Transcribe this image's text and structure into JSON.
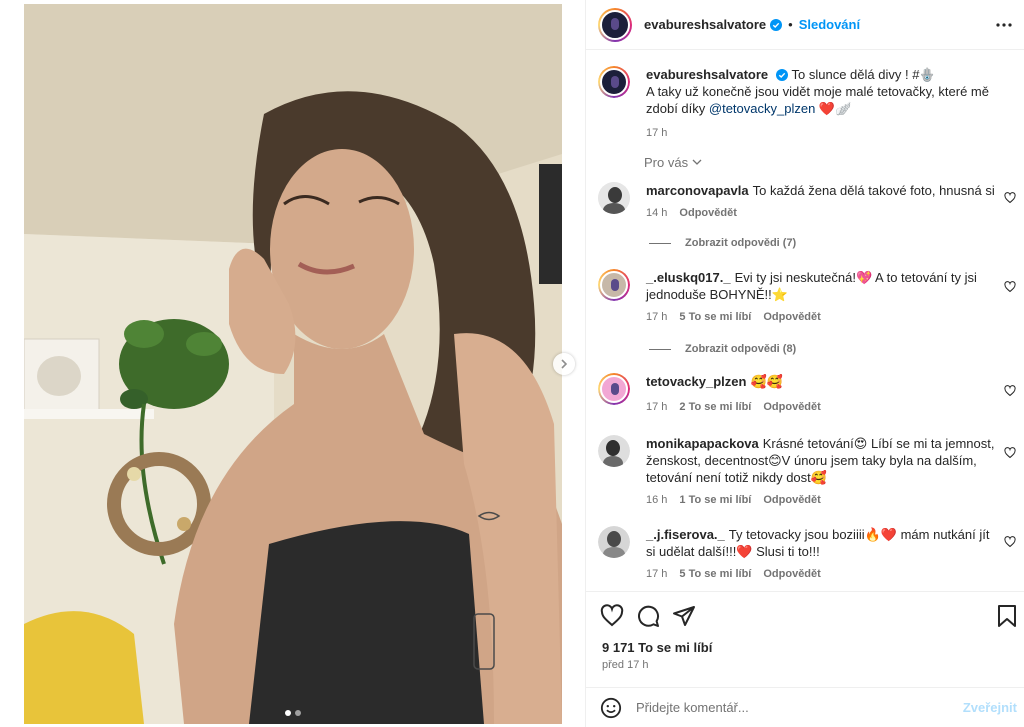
{
  "post": {
    "author": "evabureshsalvatore",
    "follow_label": "Sledování",
    "separator": "•",
    "caption_line1": "To slunce dělá divy ! #🪬",
    "caption_line2": "A taky už konečně jsou vidět moje malé tetovačky, které mě zdobí díky",
    "caption_mention": "@tetovacky_plzen",
    "caption_end": " ❤️🪽",
    "time": "17 h",
    "for_you_label": "Pro vás"
  },
  "comments": [
    {
      "user": "marconovapavla",
      "text": "To každá žena dělá takové foto, hnusná si",
      "time": "14 h",
      "likes": "",
      "reply": "Odpovědět",
      "view_replies": "Zobrazit odpovědi (7)"
    },
    {
      "user": "_.eluskq017._",
      "text": "Evi ty jsi neskutečná!💖 A to tetování ty jsi jednoduše BOHYNĚ!!⭐️",
      "time": "17 h",
      "likes": "5 To se mi líbí",
      "reply": "Odpovědět",
      "view_replies": "Zobrazit odpovědi (8)"
    },
    {
      "user": "tetovacky_plzen",
      "text": "🥰🥰",
      "time": "17 h",
      "likes": "2 To se mi líbí",
      "reply": "Odpovědět",
      "view_replies": ""
    },
    {
      "user": "monikapapackova",
      "text": "Krásné tetování😍 Líbí se mi ta jemnost, ženskost, decentnost😊V únoru jsem taky byla na dalším, tetování není totiž nikdy dost🥰",
      "time": "16 h",
      "likes": "1 To se mi líbí",
      "reply": "Odpovědět",
      "view_replies": ""
    },
    {
      "user": "_.j.fiserova._",
      "text": "Ty tetovacky jsou boziiii🔥❤️ mám nutkání jít si udělat další!!!❤️ Slusi ti to!!!",
      "time": "17 h",
      "likes": "5 To se mi líbí",
      "reply": "Odpovědět",
      "view_replies": ""
    }
  ],
  "stats": {
    "likes": "9 171 To se mi líbí",
    "ago": "před 17 h"
  },
  "composer": {
    "placeholder": "Přidejte komentář...",
    "post_label": "Zveřejnit"
  },
  "carousel": {
    "current_slide": 1,
    "total_slides": 2
  },
  "colors": {
    "accent": "#0095f6",
    "verified": "#0095f6",
    "muted": "#737373",
    "mention": "#00376b"
  },
  "icons": [
    "verified-badge-icon",
    "more-options-icon",
    "chevron-down-icon",
    "heart-icon",
    "comment-icon",
    "share-icon",
    "bookmark-icon",
    "emoji-icon",
    "chevron-right-icon"
  ]
}
